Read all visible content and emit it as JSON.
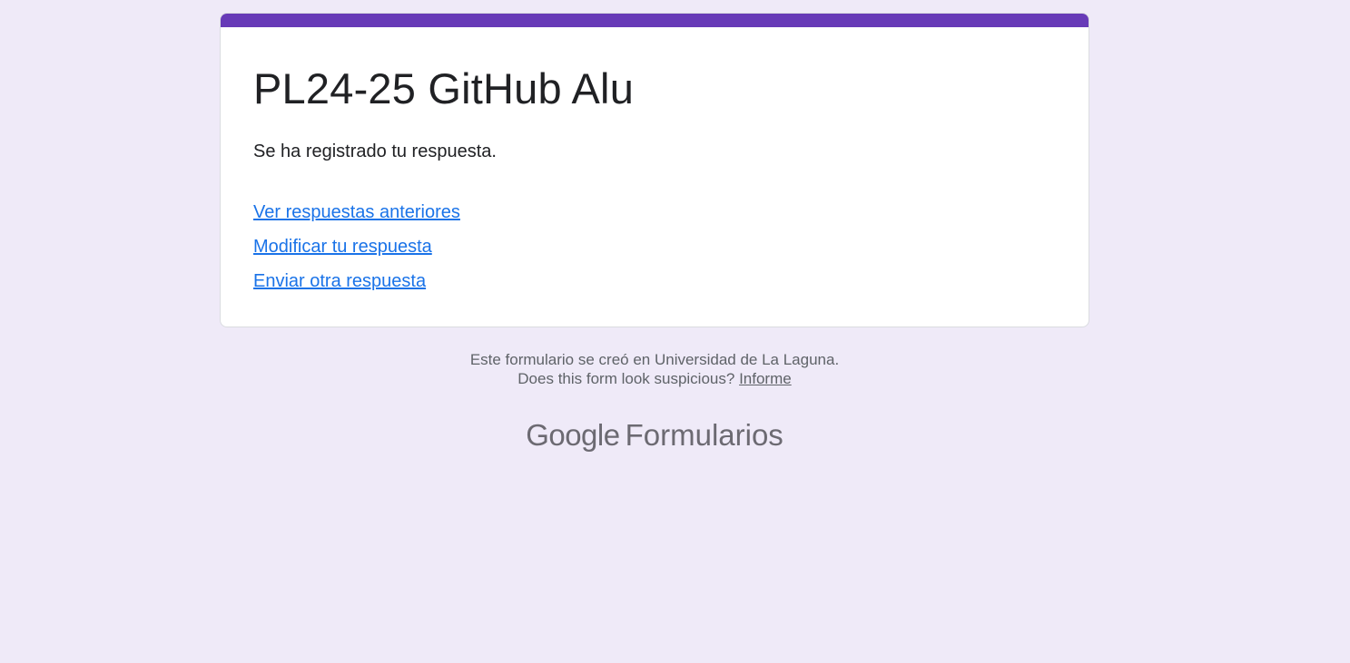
{
  "form": {
    "title": "PL24-25 GitHub Alu",
    "confirmation_message": "Se ha registrado tu respuesta.",
    "accent_color": "#673ab7",
    "background_color": "#efeaf8",
    "links": [
      {
        "label": "Ver respuestas anteriores"
      },
      {
        "label": "Modificar tu respuesta"
      },
      {
        "label": "Enviar otra respuesta"
      }
    ]
  },
  "footer": {
    "created_in": "Este formulario se creó en Universidad de La Laguna.",
    "suspicious_question": "Does this form look suspicious?",
    "report_label": "Informe"
  },
  "brand": {
    "google": "Google",
    "product": "Formularios"
  }
}
